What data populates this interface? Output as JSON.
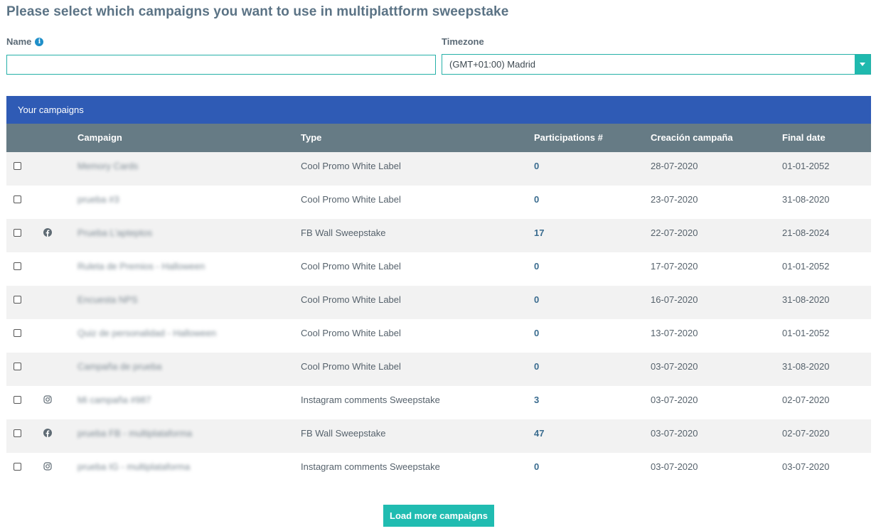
{
  "heading": "Please select which campaigns you want to use in multiplattform sweepstake",
  "form": {
    "name_label": "Name",
    "name_value": "",
    "timezone_label": "Timezone",
    "timezone_value": "(GMT+01:00) Madrid"
  },
  "table": {
    "banner": "Your campaigns",
    "headers": {
      "campaign": "Campaign",
      "type": "Type",
      "participations": "Participations #",
      "created": "Creación campaña",
      "final": "Final date"
    },
    "rows": [
      {
        "network": "",
        "campaign": "Memory Cards",
        "type": "Cool Promo White Label",
        "participations": "0",
        "created": "28-07-2020",
        "final": "01-01-2052"
      },
      {
        "network": "",
        "campaign": "prueba #3",
        "type": "Cool Promo White Label",
        "participations": "0",
        "created": "23-07-2020",
        "final": "31-08-2020"
      },
      {
        "network": "facebook",
        "campaign": "Prueba L'apteptos",
        "type": "FB Wall Sweepstake",
        "participations": "17",
        "created": "22-07-2020",
        "final": "21-08-2024"
      },
      {
        "network": "",
        "campaign": "Ruleta de Premios - Halloween",
        "type": "Cool Promo White Label",
        "participations": "0",
        "created": "17-07-2020",
        "final": "01-01-2052"
      },
      {
        "network": "",
        "campaign": "Encuesta NPS",
        "type": "Cool Promo White Label",
        "participations": "0",
        "created": "16-07-2020",
        "final": "31-08-2020"
      },
      {
        "network": "",
        "campaign": "Quiz de personalidad - Halloween",
        "type": "Cool Promo White Label",
        "participations": "0",
        "created": "13-07-2020",
        "final": "01-01-2052"
      },
      {
        "network": "",
        "campaign": "Campaña de prueba",
        "type": "Cool Promo White Label",
        "participations": "0",
        "created": "03-07-2020",
        "final": "31-08-2020"
      },
      {
        "network": "instagram",
        "campaign": "Mi campaña #987",
        "type": "Instagram comments Sweepstake",
        "participations": "3",
        "created": "03-07-2020",
        "final": "02-07-2020"
      },
      {
        "network": "facebook",
        "campaign": "prueba FB - multiplataforma",
        "type": "FB Wall Sweepstake",
        "participations": "47",
        "created": "03-07-2020",
        "final": "02-07-2020"
      },
      {
        "network": "instagram",
        "campaign": "prueba IG - multiplataforma",
        "type": "Instagram comments Sweepstake",
        "participations": "0",
        "created": "03-07-2020",
        "final": "03-07-2020"
      }
    ]
  },
  "load_more_label": "Load more campaigns",
  "icons": {
    "info": "info-icon",
    "facebook": "facebook-icon",
    "instagram": "instagram-icon",
    "dropdown": "chevron-down-icon"
  },
  "colors": {
    "accent": "#1fb9ae",
    "banner": "#2f5bb5",
    "table_header": "#667b85"
  }
}
